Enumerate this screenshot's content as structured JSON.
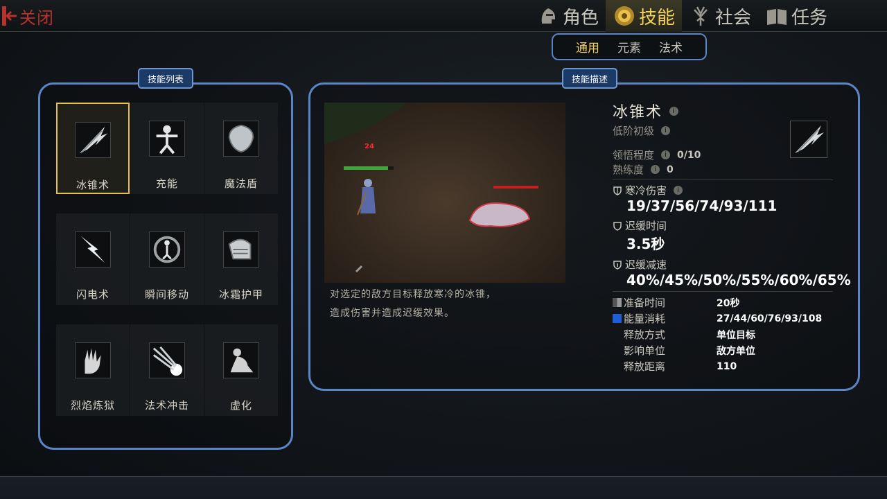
{
  "header": {
    "close_label": "关闭",
    "tabs": [
      {
        "label": "角色",
        "icon": "knight-helmet-icon"
      },
      {
        "label": "技能",
        "icon": "sun-emblem-icon"
      },
      {
        "label": "社会",
        "icon": "tree-icon"
      },
      {
        "label": "任务",
        "icon": "book-icon"
      }
    ],
    "active_tab": "技能"
  },
  "subtabs": {
    "items": [
      "通用",
      "元素",
      "法术"
    ],
    "active": "通用"
  },
  "skill_list": {
    "title": "技能列表",
    "skills": [
      {
        "name": "冰锥术",
        "icon": "ice-shard-icon",
        "selected": true
      },
      {
        "name": "充能",
        "icon": "charge-figure-icon"
      },
      {
        "name": "魔法盾",
        "icon": "magic-shield-icon"
      },
      {
        "name": "闪电术",
        "icon": "lightning-icon"
      },
      {
        "name": "瞬间移动",
        "icon": "teleport-icon"
      },
      {
        "name": "冰霜护甲",
        "icon": "frost-armor-icon"
      },
      {
        "name": "烈焰炼狱",
        "icon": "flame-hand-icon"
      },
      {
        "name": "法术冲击",
        "icon": "spell-blast-icon"
      },
      {
        "name": "虚化",
        "icon": "ethereal-figure-icon"
      }
    ]
  },
  "skill_desc": {
    "title": "技能描述",
    "preview": {
      "damage_number": "24"
    },
    "description_lines": [
      "对选定的敌方目标释放寒冷的冰锥，",
      "造成伤害并造成迟缓效果。"
    ],
    "name": "冰锥术",
    "level": "低阶初级",
    "mastery_label": "领悟程度",
    "mastery_value": "0/10",
    "proficiency_label": "熟练度",
    "proficiency_value": "0",
    "stats": [
      {
        "label": "寒冷伤害",
        "value": "19/37/56/74/93/111",
        "icon": "shield-icon"
      },
      {
        "label": "迟缓时间",
        "value": "3.5秒",
        "icon": "shield-icon"
      },
      {
        "label": "迟缓减速",
        "value": "40%/45%/50%/55%/60%/65%",
        "icon": "shield-icon"
      }
    ],
    "attributes": [
      {
        "label": "准备时间",
        "value": "20秒",
        "swatch": "#8a8a8a"
      },
      {
        "label": "能量消耗",
        "value": "27/44/60/76/93/108",
        "swatch": "#1d5fd6"
      },
      {
        "label": "释放方式",
        "value": "单位目标"
      },
      {
        "label": "影响单位",
        "value": "敌方单位"
      },
      {
        "label": "释放距离",
        "value": "110"
      }
    ]
  },
  "colors": {
    "accent_gold": "#f2d25a",
    "panel_border": "#5a86c6",
    "close_red": "#b8312c"
  }
}
